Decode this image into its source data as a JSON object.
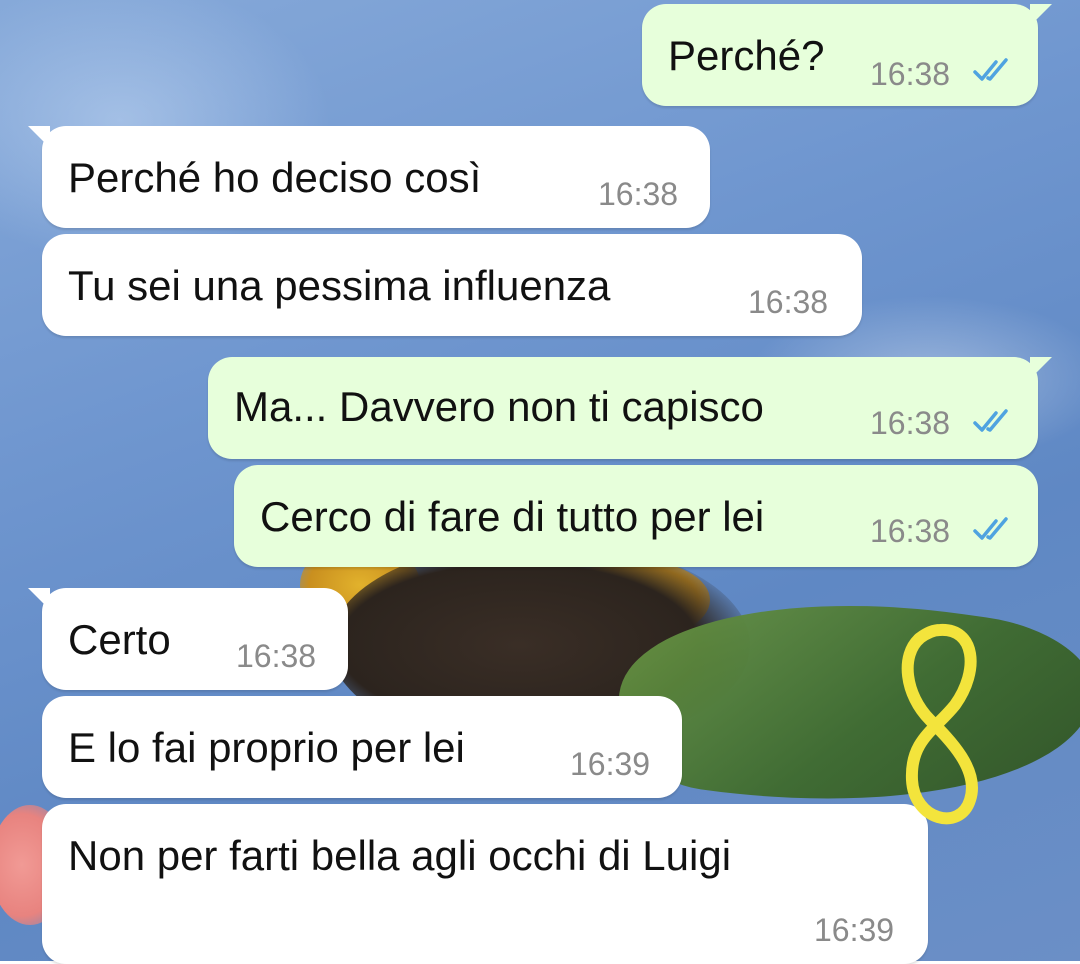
{
  "colors": {
    "incoming_bubble": "#ffffff",
    "outgoing_bubble": "#e7ffdb",
    "read_ticks": "#4fa3e0",
    "timestamp": "#8a8a8a",
    "annotation": "#f3e43c"
  },
  "annotation": {
    "icon": "handwritten-eight",
    "text": "8"
  },
  "messages": [
    {
      "direction": "outgoing",
      "text": "Perché?",
      "time": "16:38",
      "status": "read"
    },
    {
      "direction": "incoming",
      "text": "Perché ho deciso così",
      "time": "16:38"
    },
    {
      "direction": "incoming",
      "text": "Tu sei una pessima influenza",
      "time": "16:38"
    },
    {
      "direction": "outgoing",
      "text": "Ma... Davvero non ti capisco",
      "time": "16:38",
      "status": "read"
    },
    {
      "direction": "outgoing",
      "text": "Cerco di fare di tutto per lei",
      "time": "16:38",
      "status": "read"
    },
    {
      "direction": "incoming",
      "text": "Certo",
      "time": "16:38"
    },
    {
      "direction": "incoming",
      "text": "E lo fai proprio per lei",
      "time": "16:39"
    },
    {
      "direction": "incoming",
      "text": "Non per farti bella agli occhi di Luigi",
      "time": "16:39"
    }
  ]
}
